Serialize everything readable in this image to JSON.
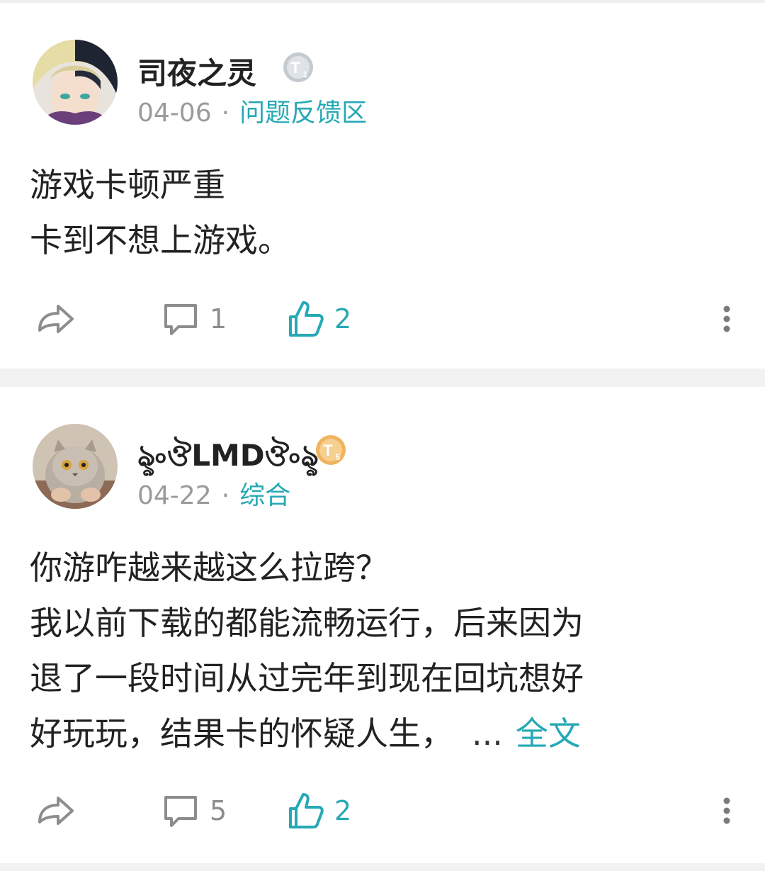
{
  "posts": [
    {
      "username": "司夜之灵",
      "badge": {
        "letter": "T",
        "level": "1",
        "color": "#b9bec4"
      },
      "date": "04-06",
      "category": "问题反馈区",
      "lines": [
        "游戏卡顿严重",
        "卡到不想上游戏。"
      ],
      "comments": "1",
      "likes": "2"
    },
    {
      "username": "ৡ৹ঔLMDঔ৹ৡ",
      "badge": {
        "letter": "T",
        "level": "5",
        "color": "#f2b25a"
      },
      "date": "04-22",
      "category": "综合",
      "lines": [
        "你游咋越来越这么拉跨？",
        "我以前下载的都能流畅运行，后来因为",
        "退了一段时间从过完年到现在回坑想好",
        "好玩玩，结果卡的怀疑人生，"
      ],
      "ellipsis": "...",
      "full_text": "全文",
      "comments": "5",
      "likes": "2"
    }
  ],
  "icons": [
    "share-icon",
    "comment-icon",
    "like-icon",
    "more-icon"
  ],
  "colors": {
    "accent": "#25a9b5",
    "meta": "#9a9a9a",
    "icon_gray": "#8d8d8d"
  }
}
